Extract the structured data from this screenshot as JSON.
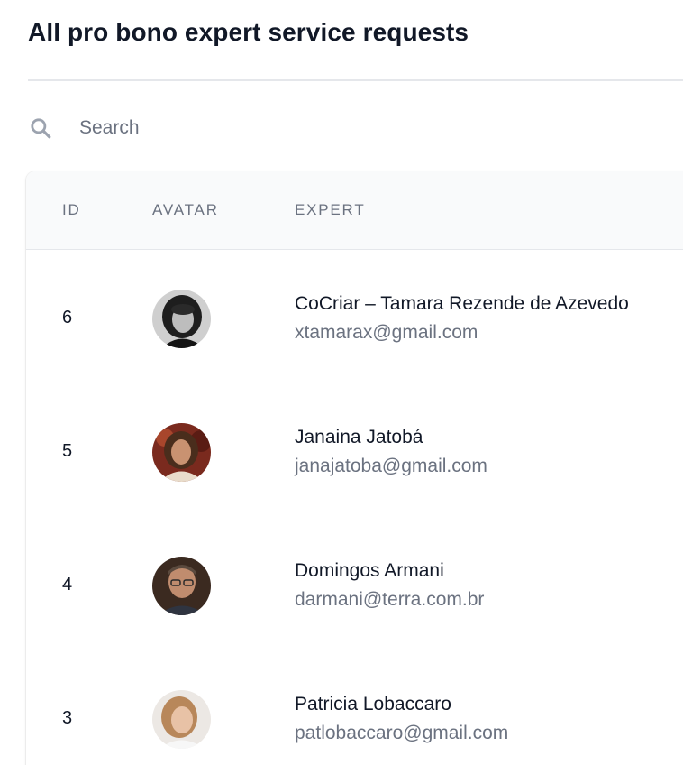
{
  "header": {
    "title": "All pro bono expert service requests"
  },
  "search": {
    "placeholder": "Search",
    "value": "",
    "icon": "search-icon"
  },
  "table": {
    "columns": [
      {
        "key": "id",
        "label": "ID"
      },
      {
        "key": "avatar",
        "label": "AVATAR"
      },
      {
        "key": "expert",
        "label": "EXPERT"
      }
    ],
    "rows": [
      {
        "id": "6",
        "name": "CoCriar – Tamara Rezende de Azevedo",
        "email": "xtamarax@gmail.com",
        "avatar": "grayscale-portrait-dark-hair"
      },
      {
        "id": "5",
        "name": "Janaina Jatobá",
        "email": "janajatoba@gmail.com",
        "avatar": "portrait-curly-hair-warm-background"
      },
      {
        "id": "4",
        "name": "Domingos Armani",
        "email": "darmani@terra.com.br",
        "avatar": "portrait-man-glasses"
      },
      {
        "id": "3",
        "name": "Patricia Lobaccaro",
        "email": "patlobaccaro@gmail.com",
        "avatar": "portrait-woman-light-hair"
      }
    ]
  },
  "colors": {
    "text_primary": "#111827",
    "text_secondary": "#6b7280",
    "header_bg": "#f9fafb",
    "divider": "#e5e7eb"
  }
}
